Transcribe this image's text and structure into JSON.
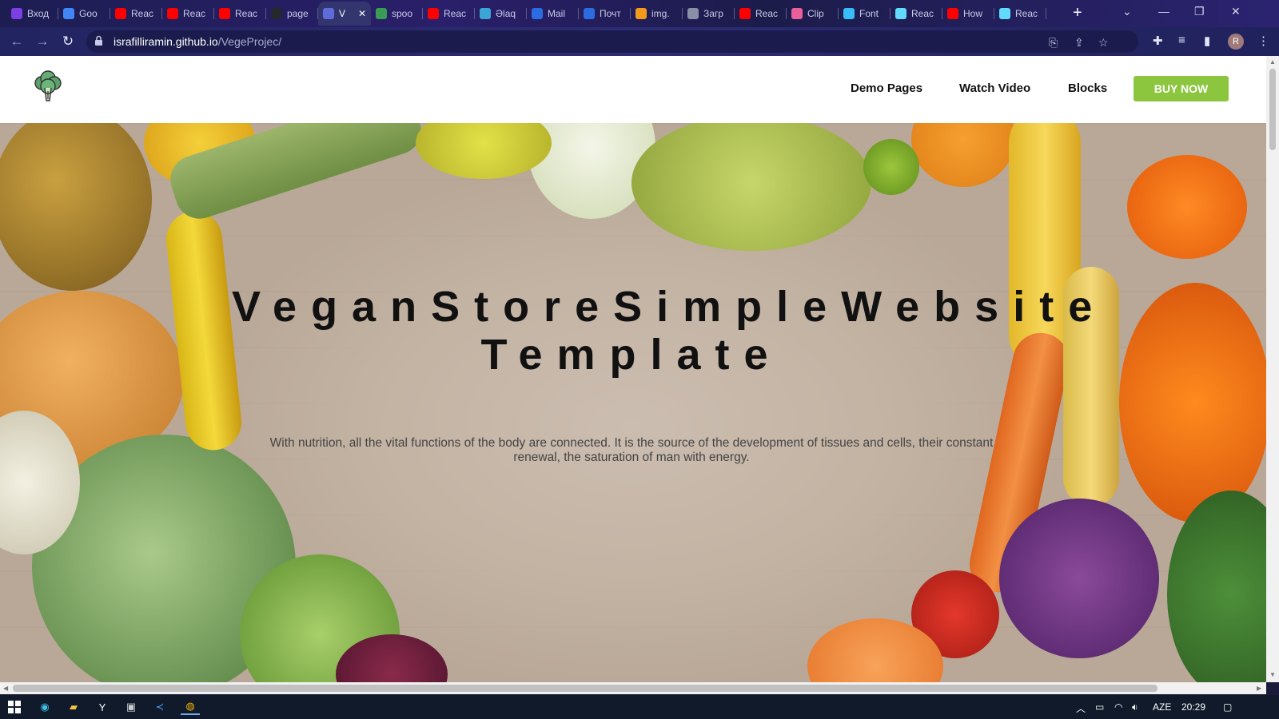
{
  "browser": {
    "tabs": [
      {
        "title": "Вход",
        "icon": "mail-icon",
        "color": "#7b3fe4"
      },
      {
        "title": "Goo",
        "icon": "translate-icon",
        "color": "#4285f4"
      },
      {
        "title": "Reac",
        "icon": "youtube-icon",
        "color": "#ff0000"
      },
      {
        "title": "Reac",
        "icon": "youtube-icon",
        "color": "#ff0000"
      },
      {
        "title": "Reac",
        "icon": "youtube-icon",
        "color": "#ff0000"
      },
      {
        "title": "page",
        "icon": "github-icon",
        "color": "#24292e"
      },
      {
        "title": "V",
        "icon": "globe-icon",
        "color": "#5f6bd8",
        "active": true
      },
      {
        "title": "spoo",
        "icon": "spoonacular-icon",
        "color": "#3a9b55"
      },
      {
        "title": "Reac",
        "icon": "youtube-icon",
        "color": "#ff0000"
      },
      {
        "title": "Əlaq",
        "icon": "pen-icon",
        "color": "#3aa6d8"
      },
      {
        "title": "Mail",
        "icon": "at-icon",
        "color": "#2b6de0"
      },
      {
        "title": "Почт",
        "icon": "envelope-icon",
        "color": "#2b6de0"
      },
      {
        "title": "img.",
        "icon": "cloud-icon",
        "color": "#f29a1b"
      },
      {
        "title": "Загр",
        "icon": "stack-icon",
        "color": "#8a8fa8"
      },
      {
        "title": "Reac",
        "icon": "youtube-icon",
        "color": "#ff0000"
      },
      {
        "title": "Clip",
        "icon": "dots-icon",
        "color": "#e95f9a"
      },
      {
        "title": "Font",
        "icon": "wave-icon",
        "color": "#38bdf8"
      },
      {
        "title": "Reac",
        "icon": "react-icon",
        "color": "#61dafb"
      },
      {
        "title": "How",
        "icon": "youtube-icon",
        "color": "#ff0000"
      },
      {
        "title": "Reac",
        "icon": "react-icon",
        "color": "#61dafb"
      }
    ],
    "url_host": "israfilliramin.github.io",
    "url_path": "/VegeProjec/",
    "profile_initial": "R"
  },
  "site": {
    "nav": {
      "demo_pages": "Demo Pages",
      "watch_video": "Watch Video",
      "blocks": "Blocks",
      "buy_now": "BUY NOW"
    },
    "hero": {
      "title_line1": "VeganStoreSimpleWebsite",
      "title_line2": "Template",
      "description": "With nutrition, all the vital functions of the body are connected. It is the source of the development of tissues and cells, their constant renewal, the saturation of man with energy."
    },
    "accent_color": "#8cc63f"
  },
  "taskbar": {
    "language": "AZE",
    "time": "20:29"
  }
}
